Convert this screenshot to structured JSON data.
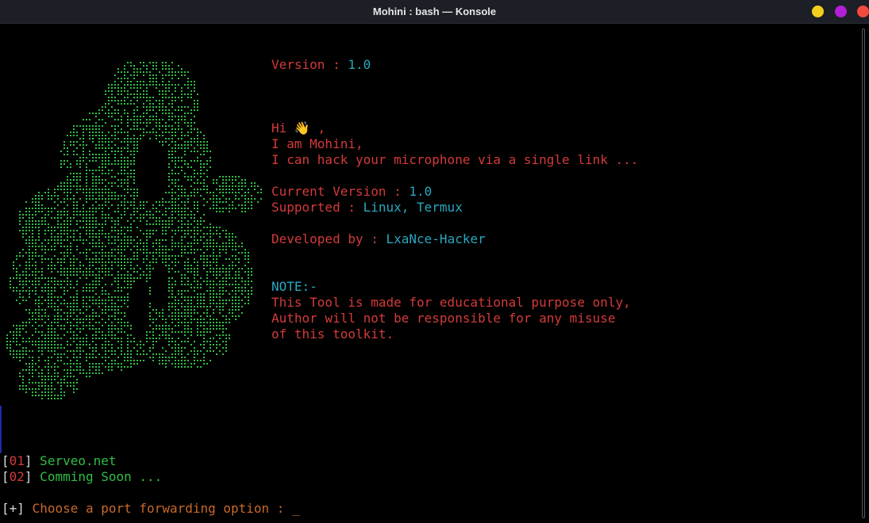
{
  "window": {
    "title": "Mohini : bash — Konsole",
    "buttons": {
      "minimize_color": "#f2cf1c",
      "maximize_color": "#b21fd6",
      "close_color": "#f24b3d"
    }
  },
  "colors": {
    "red": "#d33a3a",
    "cyan": "#2aa7bf",
    "green": "#2fbf45",
    "orange": "#c9692a"
  },
  "banner": {
    "version_label": "Version : ",
    "version_value": "1.0",
    "hi_label": "Hi ",
    "hi_emoji": "👋",
    "hi_suffix": " ,",
    "iam": "I am Mohini,",
    "hack": "I can hack your microphone via a single link ...",
    "current_version_label": "Current Version : ",
    "current_version_value": "1.0",
    "supported_label": "Supported : ",
    "supported_value": "Linux, Termux",
    "developed_label": "Developed by : ",
    "developed_value": "LxaNce-Hacker",
    "note_title": "NOTE:-",
    "note_line1": "This Tool is made for educational purpose only,",
    "note_line2": "Author will not be responsible for any misuse",
    "note_line3": "of this toolkit."
  },
  "menu": {
    "options": [
      {
        "open": "[",
        "num": "01",
        "close": "]",
        "label": " Serveo.net"
      },
      {
        "open": "[",
        "num": "02",
        "close": "]",
        "label": " Comming Soon ..."
      }
    ]
  },
  "prompt": {
    "open": "[",
    "symbol": "+",
    "close": "]",
    "text": " Choose a port forwarding option : ",
    "cursor": "_"
  }
}
